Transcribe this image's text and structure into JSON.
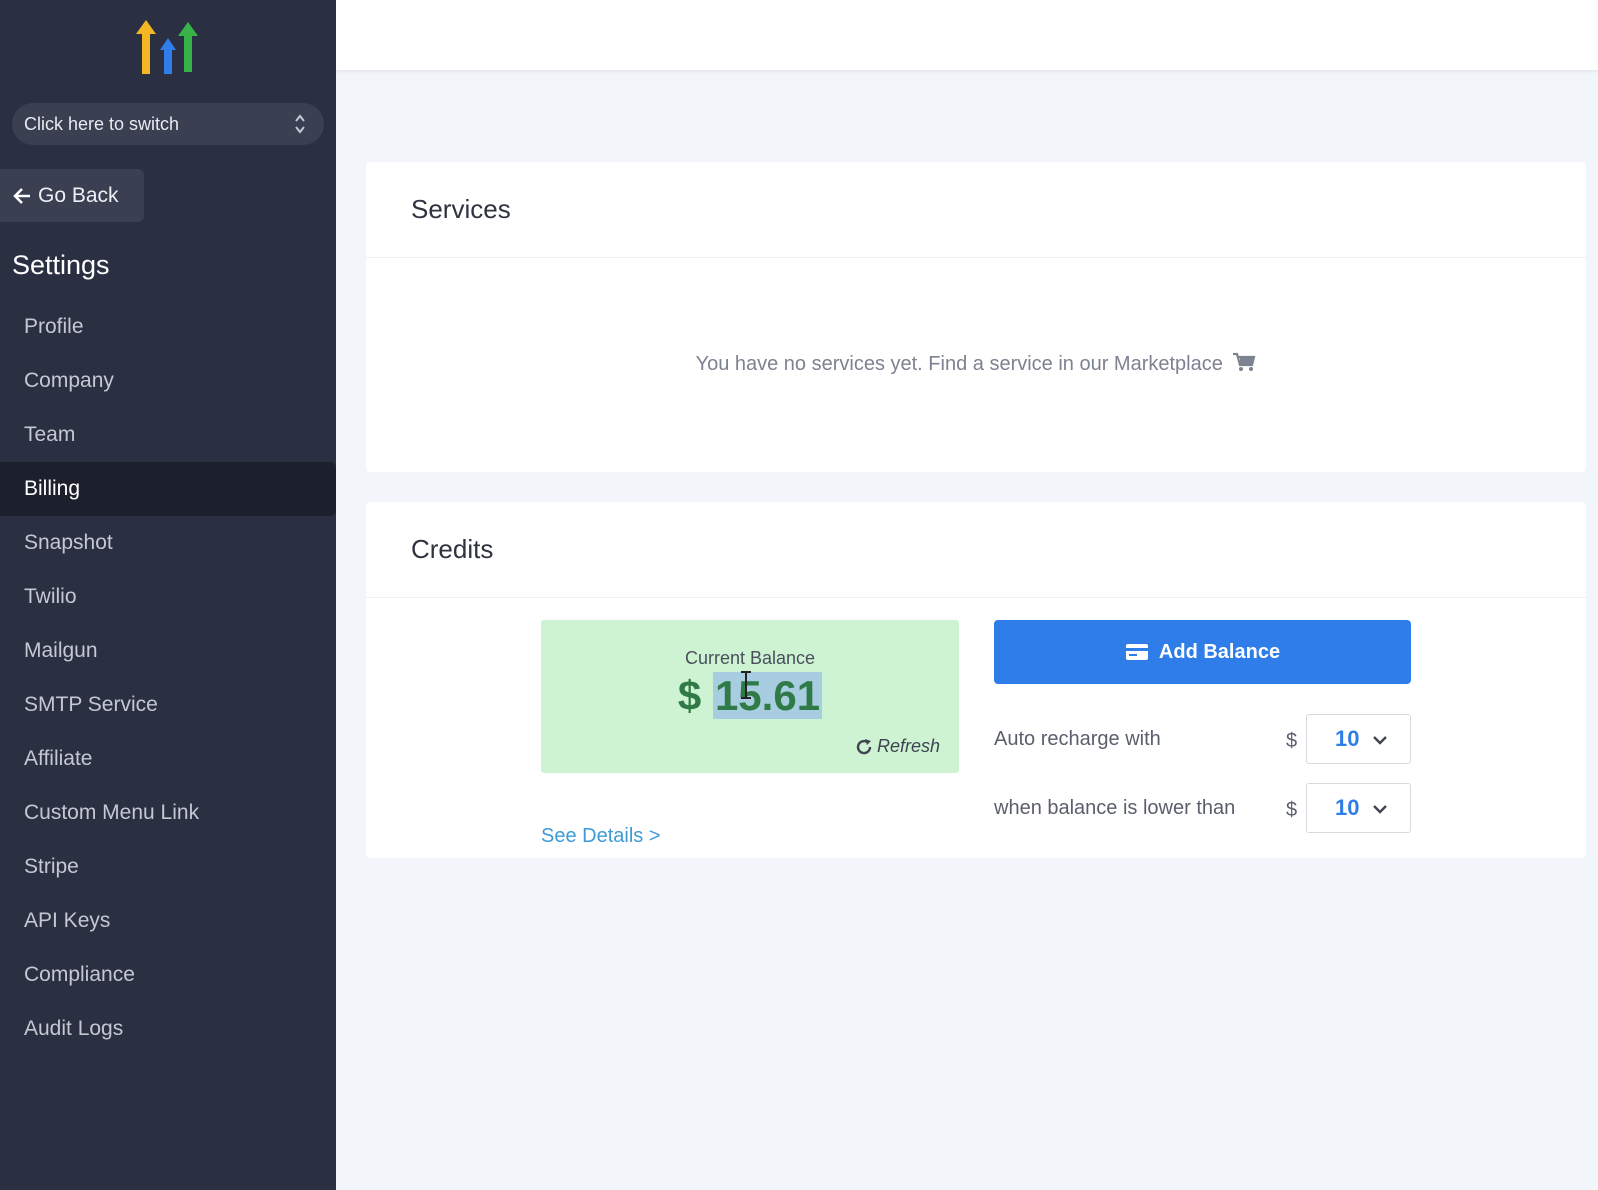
{
  "sidebar": {
    "switcher_label": "Click here to switch",
    "go_back_label": "Go Back",
    "settings_title": "Settings",
    "items": [
      {
        "label": "Profile"
      },
      {
        "label": "Company"
      },
      {
        "label": "Team"
      },
      {
        "label": "Billing",
        "active": true
      },
      {
        "label": "Snapshot"
      },
      {
        "label": "Twilio"
      },
      {
        "label": "Mailgun"
      },
      {
        "label": "SMTP Service"
      },
      {
        "label": "Affiliate"
      },
      {
        "label": "Custom Menu Link"
      },
      {
        "label": "Stripe"
      },
      {
        "label": "API Keys"
      },
      {
        "label": "Compliance"
      },
      {
        "label": "Audit Logs"
      }
    ]
  },
  "services": {
    "title": "Services",
    "empty_message": "You have no services yet. Find a service in our Marketplace"
  },
  "credits": {
    "title": "Credits",
    "balance_label": "Current Balance",
    "currency_symbol": "$",
    "balance_value": "15.61",
    "refresh_label": "Refresh",
    "see_details_label": "See Details >",
    "add_balance_label": "Add Balance",
    "auto_recharge_label": "Auto recharge with",
    "auto_recharge_currency": "$",
    "auto_recharge_value": "10",
    "threshold_label": "when balance is lower than",
    "threshold_currency": "$",
    "threshold_value": "10"
  },
  "colors": {
    "sidebar_bg": "#2a2f42",
    "active_item_bg": "#1c1f2c",
    "primary": "#2f7de9",
    "balance_bg": "#cdf3d3",
    "balance_text": "#2f7a47",
    "link": "#3e9bd6"
  },
  "icons": {
    "logo": "upward-arrows-logo",
    "switcher": "chevron-up-down-icon",
    "go_back": "arrow-left-icon",
    "cart": "cart-icon",
    "refresh": "refresh-icon",
    "add_balance": "credit-card-icon",
    "select": "chevron-down-icon"
  }
}
